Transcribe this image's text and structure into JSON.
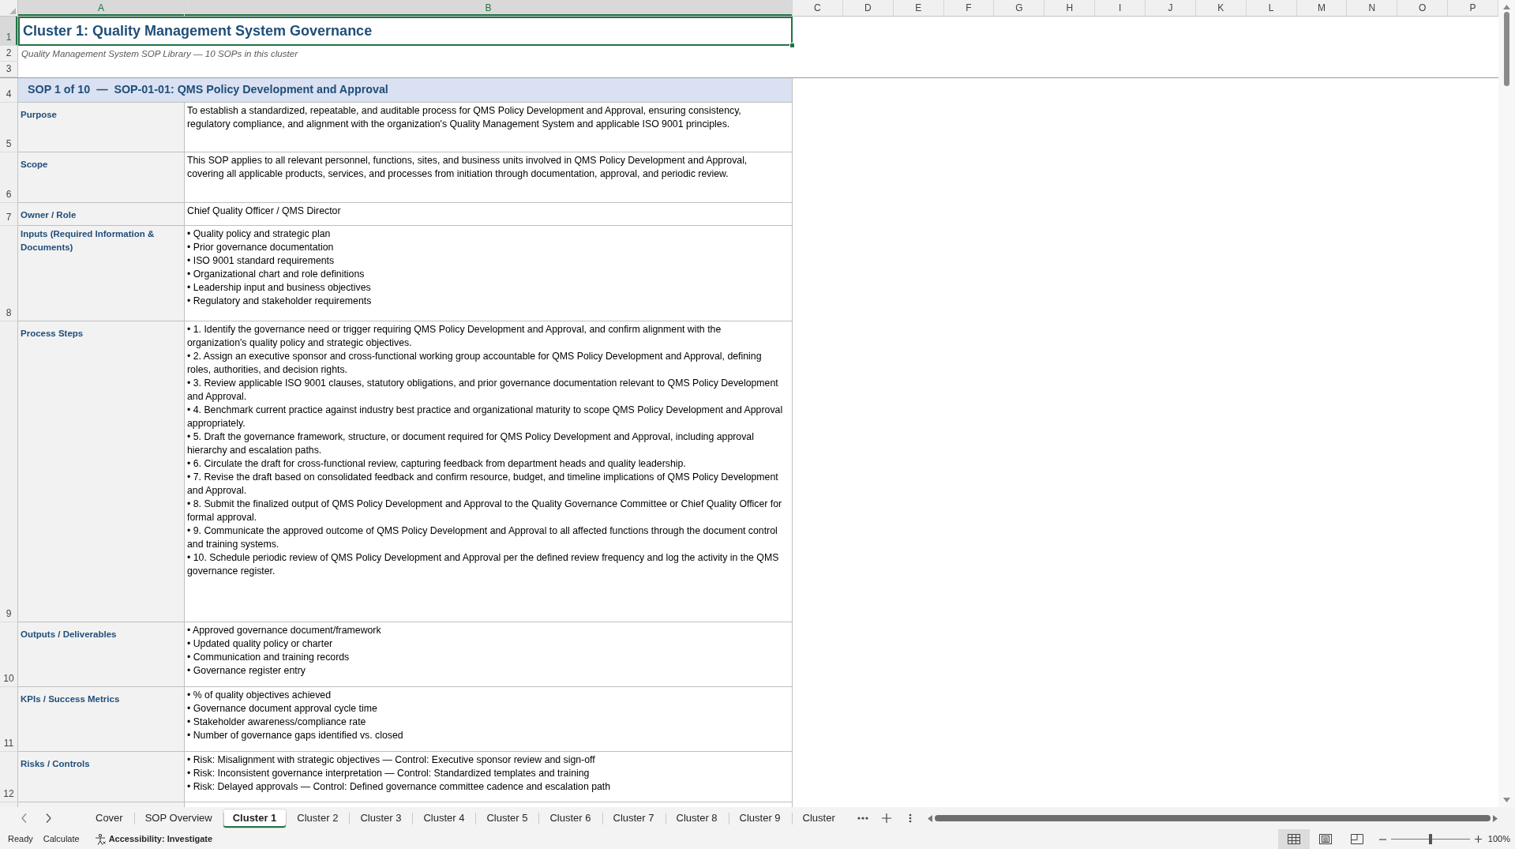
{
  "sheet": {
    "columns": [
      {
        "label": "A",
        "selected": true
      },
      {
        "label": "B",
        "selected": true
      },
      {
        "label": "C",
        "selected": false
      },
      {
        "label": "D",
        "selected": false
      },
      {
        "label": "E",
        "selected": false
      },
      {
        "label": "F",
        "selected": false
      },
      {
        "label": "G",
        "selected": false
      },
      {
        "label": "H",
        "selected": false
      },
      {
        "label": "I",
        "selected": false
      },
      {
        "label": "J",
        "selected": false
      },
      {
        "label": "K",
        "selected": false
      },
      {
        "label": "L",
        "selected": false
      },
      {
        "label": "M",
        "selected": false
      },
      {
        "label": "N",
        "selected": false
      },
      {
        "label": "O",
        "selected": false
      },
      {
        "label": "P",
        "selected": false
      }
    ],
    "rows": [
      {
        "kind": "title",
        "row": "1",
        "selected": true,
        "text": "Cluster 1: Quality Management System Governance"
      },
      {
        "kind": "subtitle",
        "row": "2",
        "selected": false,
        "text": "Quality Management System SOP Library — 10 SOPs in this cluster"
      },
      {
        "kind": "blank",
        "row": "3",
        "selected": false
      },
      {
        "kind": "section",
        "row": "4",
        "selected": false,
        "text": "SOP 1 of 10  —  SOP-01-01: QMS Policy Development and Approval"
      },
      {
        "kind": "field",
        "row": "5",
        "selected": false,
        "label": "Purpose",
        "value": "To establish a standardized, repeatable, and auditable process for QMS Policy Development and Approval, ensuring consistency, regulatory compliance, and alignment with the organization's Quality Management System and applicable ISO 9001 principles."
      },
      {
        "kind": "field",
        "row": "6",
        "selected": false,
        "label": "Scope",
        "value": "This SOP applies to all relevant personnel, functions, sites, and business units involved in QMS Policy Development and Approval, covering all applicable products, services, and processes from initiation through documentation, approval, and periodic review."
      },
      {
        "kind": "field",
        "row": "7",
        "selected": false,
        "label": "Owner / Role",
        "value": "Chief Quality Officer / QMS Director"
      },
      {
        "kind": "list",
        "row": "8",
        "selected": false,
        "label": "Inputs (Required Information & Documents)",
        "items": [
          "• Quality policy and strategic plan",
          "• Prior governance documentation",
          "• ISO 9001 standard requirements",
          "• Organizational chart and role definitions",
          "• Leadership input and business objectives",
          "• Regulatory and stakeholder requirements"
        ]
      },
      {
        "kind": "list",
        "row": "9",
        "selected": false,
        "label": "Process Steps",
        "items": [
          "• 1. Identify the governance need or trigger requiring QMS Policy Development and Approval, and confirm alignment with the organization's quality policy and strategic objectives.",
          "• 2. Assign an executive sponsor and cross-functional working group accountable for QMS Policy Development and Approval, defining roles, authorities, and decision rights.",
          "• 3. Review applicable ISO 9001 clauses, statutory obligations, and prior governance documentation relevant to QMS Policy Development and Approval.",
          "• 4. Benchmark current practice against industry best practice and organizational maturity to scope QMS Policy Development and Approval appropriately.",
          "• 5. Draft the governance framework, structure, or document required for QMS Policy Development and Approval, including approval hierarchy and escalation paths.",
          "• 6. Circulate the draft for cross-functional review, capturing feedback from department heads and quality leadership.",
          "• 7. Revise the draft based on consolidated feedback and confirm resource, budget, and timeline implications of QMS Policy Development and Approval.",
          "• 8. Submit the finalized output of QMS Policy Development and Approval to the Quality Governance Committee or Chief Quality Officer for formal approval.",
          "• 9. Communicate the approved outcome of QMS Policy Development and Approval to all affected functions through the document control and training systems.",
          "• 10. Schedule periodic review of QMS Policy Development and Approval per the defined review frequency and log the activity in the QMS governance register."
        ]
      },
      {
        "kind": "list",
        "row": "10",
        "selected": false,
        "label": "Outputs / Deliverables",
        "items": [
          "• Approved governance document/framework",
          "• Updated quality policy or charter",
          "• Communication and training records",
          "• Governance register entry"
        ]
      },
      {
        "kind": "list",
        "row": "11",
        "selected": false,
        "label": "KPIs / Success Metrics",
        "items": [
          "• % of quality objectives achieved",
          "• Governance document approval cycle time",
          "• Stakeholder awareness/compliance rate",
          "• Number of governance gaps identified vs. closed"
        ]
      },
      {
        "kind": "list",
        "row": "12",
        "selected": false,
        "label": "Risks / Controls",
        "items": [
          "• Risk: Misalignment with strategic objectives — Control: Executive sponsor review and sign-off",
          "• Risk: Inconsistent governance interpretation — Control: Standardized templates and training",
          "• Risk: Delayed approvals — Control: Defined governance committee cadence and escalation path"
        ]
      }
    ]
  },
  "sheet_tabs": {
    "tabs": [
      {
        "label": "Cover",
        "selected": false
      },
      {
        "label": "SOP Overview",
        "selected": false
      },
      {
        "label": "Cluster 1",
        "selected": true
      },
      {
        "label": "Cluster 2",
        "selected": false
      },
      {
        "label": "Cluster 3",
        "selected": false
      },
      {
        "label": "Cluster 4",
        "selected": false
      },
      {
        "label": "Cluster 5",
        "selected": false
      },
      {
        "label": "Cluster 6",
        "selected": false
      },
      {
        "label": "Cluster 7",
        "selected": false
      },
      {
        "label": "Cluster 8",
        "selected": false
      },
      {
        "label": "Cluster 9",
        "selected": false
      },
      {
        "label": "Cluster",
        "selected": false
      }
    ]
  },
  "status_bar": {
    "texts": [
      "Ready",
      "Calculate"
    ],
    "accessibility": "Accessibility: Investigate",
    "views": [
      {
        "kind": "normal",
        "selected": true
      },
      {
        "kind": "page_layout",
        "selected": false
      },
      {
        "kind": "page_break",
        "selected": false
      }
    ],
    "zoom": {
      "level": 0.5,
      "reading": "100%"
    }
  }
}
